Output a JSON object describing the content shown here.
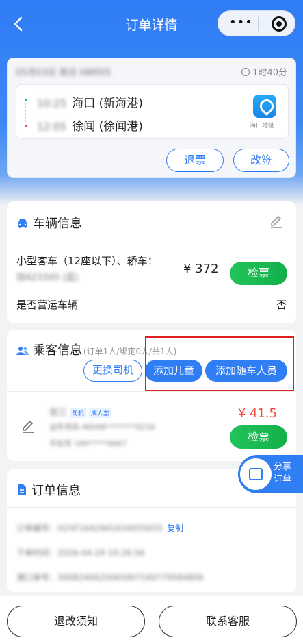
{
  "header": {
    "title": "订单详情",
    "menu_dots": "•••"
  },
  "trip": {
    "date_info": "05月03日 周日 08时05",
    "duration": "1时40分",
    "departure": {
      "time": "10:25",
      "port": "海口 (新海港)"
    },
    "arrival": {
      "time": "12:05",
      "port": "徐闻 (徐闻港)"
    },
    "port_address_label": "海口地址",
    "refund_label": "退票",
    "change_label": "改签"
  },
  "vehicle": {
    "title": "车辆信息",
    "type": "小型客车（12座以下）、轿车：",
    "plate": "琼A23345 (蓝)",
    "price": "¥ 372",
    "check_label": "检票",
    "operating_label": "是否营运车辆",
    "operating_value": "否"
  },
  "passengers": {
    "title": "乘客信息",
    "summary": "(订单1人/绑定0人/共1人)",
    "swap_driver_label": "更换司机",
    "add_child_label": "添加儿童",
    "add_accompany_label": "添加随车人员",
    "items": [
      {
        "name": "张三",
        "tag_driver": "司机",
        "tag_ticket": "成人票",
        "id_number": "证件号码 46048********0216",
        "phone": "手机号 180*****0667",
        "price": "¥ 41.5",
        "check_label": "检票"
      }
    ]
  },
  "share": {
    "line1": "分享",
    "line2": "订单"
  },
  "order": {
    "title": "订单信息",
    "order_no": "订单编号：H2XF1642841616055655",
    "copy_label": "复制",
    "order_time": "下单时间：2026-04-29 10:26:56",
    "port_no": "港口单号：3008240625065907160779584806"
  },
  "footer": {
    "notice_label": "退改须知",
    "service_label": "联系客服"
  },
  "colors": {
    "primary": "#2f7ef3",
    "green": "#13b04a",
    "price_red": "#f0483c",
    "annotation_red": "#e02020"
  }
}
